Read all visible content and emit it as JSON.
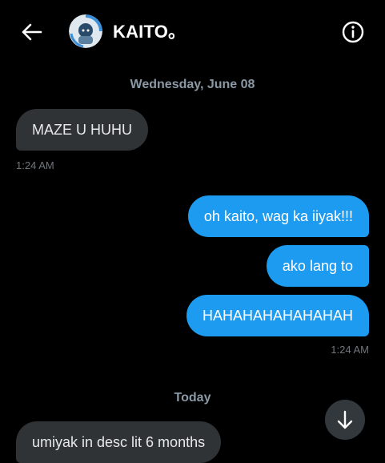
{
  "header": {
    "back_icon": "arrow-left-icon",
    "contact_name": "KAITO。",
    "info_icon": "info-circle-icon"
  },
  "conversation": {
    "date_separator_1": "Wednesday, June 08",
    "incoming_1": "MAZE U HUHU",
    "incoming_1_time": "1:24 AM",
    "outgoing": [
      "oh kaito, wag ka iiyak!!!",
      "ako lang to",
      "HAHAHAHAHAHAHAH"
    ],
    "outgoing_time": "1:24 AM",
    "date_separator_2": "Today",
    "incoming_2": "umiyak in desc lit 6 months"
  },
  "scroll_down_icon": "arrow-down-icon",
  "colors": {
    "background": "#000000",
    "incoming_bubble": "#2f3336",
    "outgoing_bubble": "#1d9bf0",
    "secondary_text": "#71767b"
  }
}
